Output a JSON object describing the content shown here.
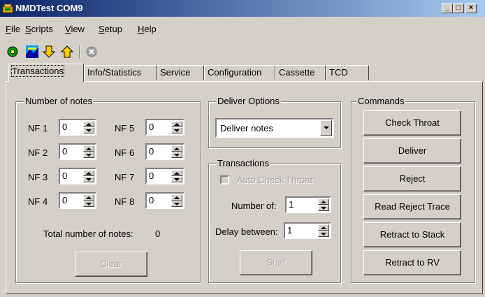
{
  "window": {
    "title": "NMDTest COM9"
  },
  "menu": [
    {
      "label": "File",
      "u": "F",
      "rest": "ile"
    },
    {
      "label": "Scripts",
      "u": "S",
      "rest": "cripts"
    },
    {
      "label": "View",
      "u": "V",
      "rest": "iew"
    },
    {
      "label": "Setup",
      "u": "S",
      "rest": "etup"
    },
    {
      "label": "Help",
      "u": "H",
      "rest": "elp"
    }
  ],
  "toolbar": [
    "gear-icon",
    "landscape-icon",
    "arrow-down-icon",
    "arrow-up-icon",
    "stop-icon"
  ],
  "tabs": [
    "Transactions",
    "Info/Statistics",
    "Service",
    "Configuration",
    "Cassette",
    "TCD"
  ],
  "notes_group": {
    "title": "Number of notes",
    "fields": [
      {
        "label": "NF 1",
        "value": "0"
      },
      {
        "label": "NF 2",
        "value": "0"
      },
      {
        "label": "NF 3",
        "value": "0"
      },
      {
        "label": "NF 4",
        "value": "0"
      },
      {
        "label": "NF 5",
        "value": "0"
      },
      {
        "label": "NF 6",
        "value": "0"
      },
      {
        "label": "NF 7",
        "value": "0"
      },
      {
        "label": "NF 8",
        "value": "0"
      }
    ],
    "total_label": "Total number of notes:",
    "total_value": "0",
    "clear_label": "Clear"
  },
  "deliver_options": {
    "title": "Deliver Options",
    "selected": "Deliver notes"
  },
  "transactions_group": {
    "title": "Transactions",
    "auto_check_label": "Auto Check Throat",
    "number_label": "Number of:",
    "number_value": "1",
    "delay_label": "Delay between:",
    "delay_value": "1",
    "start_label": "Start"
  },
  "commands": {
    "title": "Commands",
    "buttons": [
      "Check Throat",
      "Deliver",
      "Reject",
      "Read Reject Trace",
      "Retract to Stack",
      "Retract to RV"
    ]
  }
}
